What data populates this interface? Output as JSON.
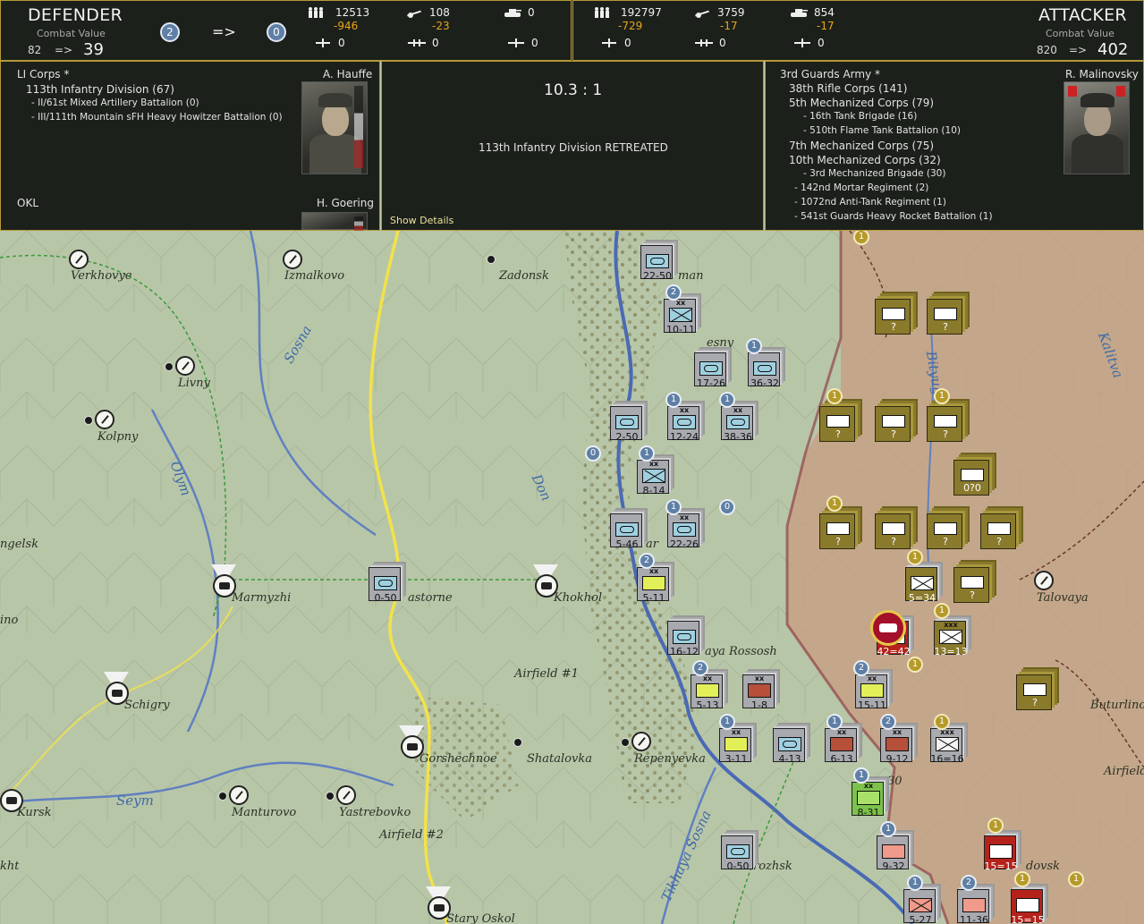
{
  "defender": {
    "title": "DEFENDER",
    "combat_value_label": "Combat Value",
    "cv_from": "82",
    "cv_arrow": "=>",
    "cv_to": "39",
    "badge_before": "2",
    "badge_arrow": "=>",
    "badge_after": "0",
    "men": "12513",
    "men_delta": "-946",
    "guns": "108",
    "guns_delta": "-23",
    "tanks": "0",
    "fighters": "0",
    "bombers": "0",
    "transports": "0"
  },
  "attacker": {
    "title": "ATTACKER",
    "combat_value_label": "Combat Value",
    "cv_from": "820",
    "cv_arrow": "=>",
    "cv_to": "402",
    "men": "192797",
    "men_delta": "-729",
    "guns": "3759",
    "guns_delta": "-17",
    "tanks": "854",
    "tanks_delta": "-17",
    "fighters": "0",
    "bombers": "0",
    "transports": "0"
  },
  "left_panel": {
    "corps": "LI Corps *",
    "commander": "A. Hauffe",
    "division": "113th Infantry Division (67)",
    "sub1": "- II/61st Mixed Artillery Battalion (0)",
    "sub2": "- III/111th Mountain sFH Heavy Howitzer Battalion (0)",
    "air_hq": "OKL",
    "air_commander": "H. Goering"
  },
  "mid_panel": {
    "odds": "10.3 : 1",
    "result": "113th Infantry Division RETREATED",
    "show_details": "Show Details"
  },
  "right_panel": {
    "army": "3rd Guards Army *",
    "commander": "R. Malinovsky",
    "lines": [
      "38th Rifle Corps (141)",
      "5th Mechanized Corps (79)",
      "- 16th Tank Brigade (16)",
      "- 510th Flame Tank Battalion (10)",
      "7th Mechanized Corps (75)",
      "10th Mechanized Corps (32)",
      "- 3rd Mechanized Brigade (30)",
      "- 142nd Mortar Regiment (2)",
      "- 1072nd Anti-Tank Regiment (1)",
      "- 541st Guards Heavy Rocket Battalion (1)"
    ]
  },
  "map": {
    "places": [
      "Verkhovye",
      "Izmalkovo",
      "Zadonsk",
      "Livny",
      "Kolpny",
      "Marmyzhi",
      "Khokhol",
      "Airfield #1",
      "Schigry",
      "Gorshechnoe",
      "Shatalovka",
      "Repenyevka",
      "Kursk",
      "Manturovo",
      "Yastrebovko",
      "Airfield #2",
      "Stary Oskol",
      "Talovaya",
      "Buturlino",
      "Airfield",
      "ngelsk",
      "ino",
      "kht",
      "man",
      "esny",
      "ar",
      "astorne",
      "aya Rossosh",
      "rozhsk",
      "dovsk",
      "30"
    ],
    "rivers": [
      "Sosna",
      "Olym",
      "Don",
      "Seym",
      "Tikhaya Sosna",
      "Bityug",
      "Kalitva"
    ],
    "units": [
      {
        "label": "22-50"
      },
      {
        "label": "10-11"
      },
      {
        "label": "17-26"
      },
      {
        "label": "36-32"
      },
      {
        "label": "2-50"
      },
      {
        "label": "12-24"
      },
      {
        "label": "38-36"
      },
      {
        "label": "8-14"
      },
      {
        "label": "5-46"
      },
      {
        "label": "22-26"
      },
      {
        "label": "5-11"
      },
      {
        "label": "16-12"
      },
      {
        "label": "5-13"
      },
      {
        "label": "1-8"
      },
      {
        "label": "3-11"
      },
      {
        "label": "4-13"
      },
      {
        "label": "6-13"
      },
      {
        "label": "9-12"
      },
      {
        "label": "15-11"
      },
      {
        "label": "16=16"
      },
      {
        "label": "8-31"
      },
      {
        "label": "9-32"
      },
      {
        "label": "0-50"
      },
      {
        "label": "5-27"
      },
      {
        "label": "11-36"
      },
      {
        "label": "15=15"
      },
      {
        "label": "15=15"
      },
      {
        "label": "5=34"
      },
      {
        "label": "13=13"
      },
      {
        "label": "42=42"
      },
      {
        "label": "0-50"
      }
    ],
    "hq_marks": [
      "?",
      "?",
      "?",
      "?",
      "?",
      "?",
      "0?0",
      "?",
      "?",
      "?",
      "?",
      "?",
      "?",
      "?",
      "?"
    ]
  }
}
